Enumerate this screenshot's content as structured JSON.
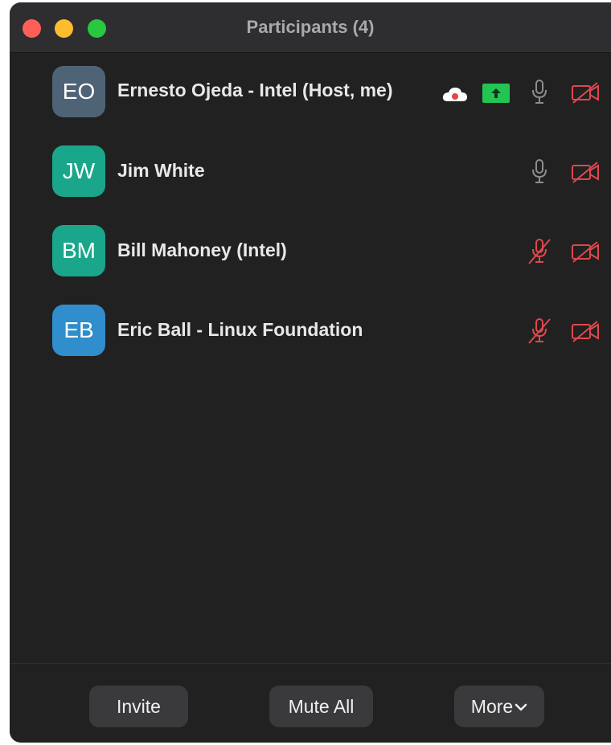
{
  "window": {
    "title": "Participants (4)"
  },
  "participants": [
    {
      "initials": "EO",
      "name": "Ernesto Ojeda - Intel (Host, me)",
      "avatar_color": "#4f6377",
      "mic": "on",
      "video": "off",
      "recording": true,
      "sharing": true
    },
    {
      "initials": "JW",
      "name": "Jim White",
      "avatar_color": "#1aa68a",
      "mic": "on",
      "video": "off"
    },
    {
      "initials": "BM",
      "name": "Bill Mahoney (Intel)",
      "avatar_color": "#1aa68a",
      "mic": "muted",
      "video": "off"
    },
    {
      "initials": "EB",
      "name": "Eric Ball - Linux Foundation",
      "avatar_color": "#2f8ecb",
      "mic": "muted",
      "video": "off"
    }
  ],
  "footer": {
    "invite_label": "Invite",
    "mute_all_label": "Mute All",
    "more_label": "More"
  },
  "colors": {
    "window_bg": "#212121",
    "titlebar_bg": "#2e2d2f",
    "muted_red": "#e0474c",
    "mic_gray": "#8d8d8f",
    "share_green": "#23c552",
    "button_bg": "#3a393b"
  },
  "icons": {
    "recording": "cloud-recording-icon",
    "sharing": "screen-share-icon",
    "mic_on": "microphone-icon",
    "mic_muted": "microphone-muted-icon",
    "video_off": "video-off-icon",
    "more": "chevron-down-icon"
  }
}
